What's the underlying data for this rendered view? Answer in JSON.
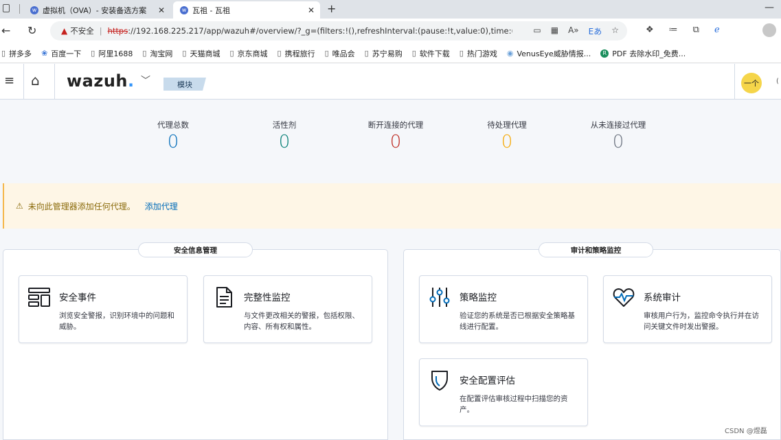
{
  "browser": {
    "tabs": [
      {
        "label": "虚拟机（OVA）- 安装备选方案",
        "active": false
      },
      {
        "label": "瓦祖 - 瓦祖",
        "active": true
      }
    ],
    "new_tab": "+",
    "minimize": "—",
    "address": {
      "insecure_label": "不安全",
      "url_scheme": "https",
      "url_rest": "://192.168.225.217/app/wazuh#/overview/?_g=(filters:!(),refreshInterval:(pause:!t,value:0),time:(..."
    },
    "bookmarks": [
      {
        "label": "拼多多",
        "icon": "page-icon"
      },
      {
        "label": "百度一下",
        "icon": "paw-icon"
      },
      {
        "label": "阿里1688",
        "icon": "page-icon"
      },
      {
        "label": "淘宝网",
        "icon": "page-icon"
      },
      {
        "label": "天猫商城",
        "icon": "page-icon"
      },
      {
        "label": "京东商城",
        "icon": "page-icon"
      },
      {
        "label": "携程旅行",
        "icon": "page-icon"
      },
      {
        "label": "唯品会",
        "icon": "page-icon"
      },
      {
        "label": "苏宁易购",
        "icon": "page-icon"
      },
      {
        "label": "软件下载",
        "icon": "page-icon"
      },
      {
        "label": "热门游戏",
        "icon": "page-icon"
      },
      {
        "label": "VenusEye威胁情报...",
        "icon": "globe-icon"
      },
      {
        "label": "PDF 去除水印_免费...",
        "icon": "pdf-icon"
      }
    ]
  },
  "header": {
    "logo": "wazuh",
    "logo_dot": ".",
    "breadcrumb": "模块",
    "avatar": "一个"
  },
  "stats": [
    {
      "label": "代理总数",
      "value": "0",
      "color": "#006bb8"
    },
    {
      "label": "活性剂",
      "value": "0",
      "color": "#017d73"
    },
    {
      "label": "断开连接的代理",
      "value": "0",
      "color": "#bd271e"
    },
    {
      "label": "待处理代理",
      "value": "0",
      "color": "#f5a700"
    },
    {
      "label": "从未连接过代理",
      "value": "0",
      "color": "#69707d"
    }
  ],
  "callout": {
    "text": "未向此管理器添加任何代理。",
    "link": "添加代理"
  },
  "sections": [
    {
      "title": "安全信息管理",
      "cards": [
        {
          "title": "安全事件",
          "desc": "浏览安全警报，识别环境中的问题和威胁。",
          "icon": "dashboard-icon"
        },
        {
          "title": "完整性监控",
          "desc": "与文件更改相关的警报，包括权限、内容、所有权和属性。",
          "icon": "document-icon"
        }
      ]
    },
    {
      "title": "审计和策略监控",
      "cards": [
        {
          "title": "策略监控",
          "desc": "验证您的系统是否已根据安全策略基线进行配置。",
          "icon": "controls-icon"
        },
        {
          "title": "系统审计",
          "desc": "审核用户行为，监控命令执行并在访问关键文件时发出警报。",
          "icon": "heart-monitor-icon"
        },
        {
          "title": "安全配置评估",
          "desc": "在配置评估审核过程中扫描您的资产。",
          "icon": "shield-icon"
        }
      ]
    }
  ],
  "watermark": "CSDN @煜磊"
}
